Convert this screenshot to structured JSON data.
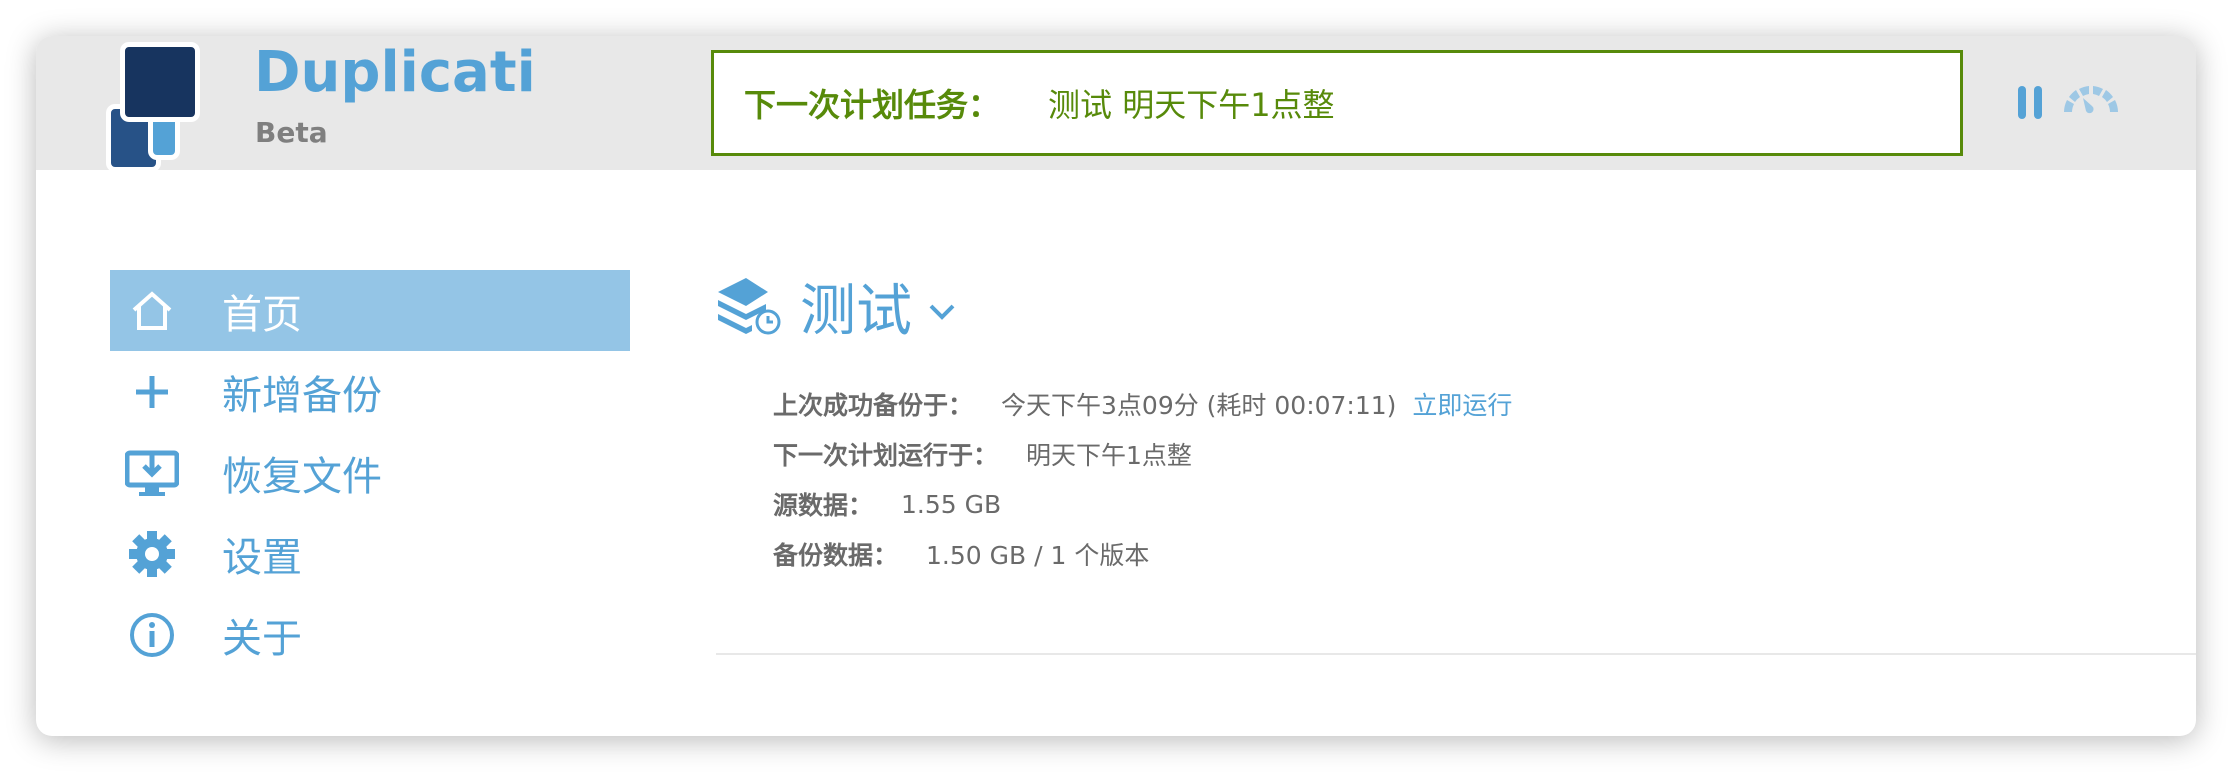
{
  "header": {
    "brand": "Duplicati",
    "edition": "Beta",
    "status_label": "下一次计划任务：",
    "status_value": "测试 明天下午1点整",
    "accent": "#54a2d6",
    "status_color": "#578a0a"
  },
  "sidebar": {
    "items": [
      {
        "label": "首页",
        "icon": "home-icon",
        "active": true
      },
      {
        "label": "新增备份",
        "icon": "plus-icon"
      },
      {
        "label": "恢复文件",
        "icon": "restore-monitor-icon"
      },
      {
        "label": "设置",
        "icon": "gear-icon"
      },
      {
        "label": "关于",
        "icon": "info-icon"
      }
    ]
  },
  "backup": {
    "name": "测试",
    "last_success_label": "上次成功备份于：",
    "last_success_value": "今天下午3点09分 (耗时 00:07:11)",
    "run_now": "立即运行",
    "next_run_label": "下一次计划运行于：",
    "next_run_value": "明天下午1点整",
    "source_label": "源数据：",
    "source_value": "1.55 GB",
    "backup_label": "备份数据：",
    "backup_value": "1.50 GB / 1 个版本"
  }
}
